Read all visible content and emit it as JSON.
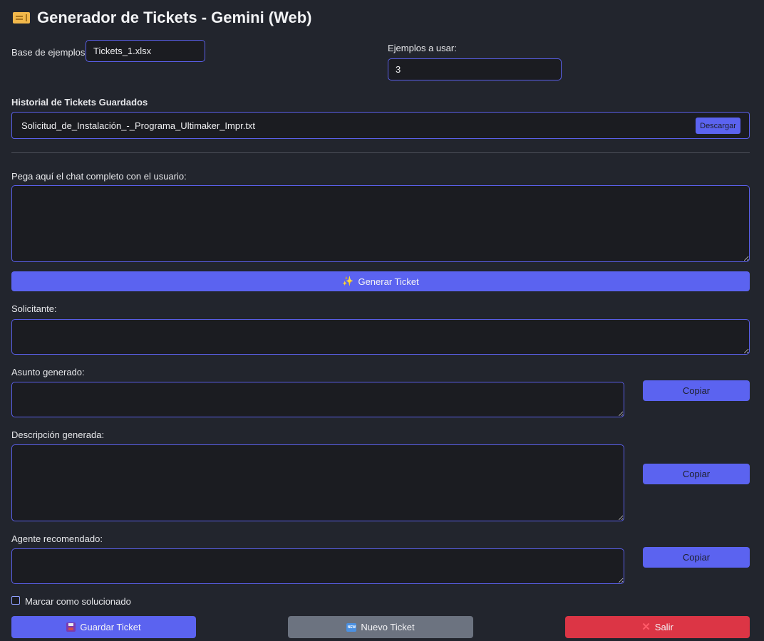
{
  "app": {
    "title": "Generador de Tickets - Gemini (Web)",
    "title_icon": "ticket-icon"
  },
  "config": {
    "base_label": "Base de ejemplos:",
    "base_value": "Tickets_1.xlsx",
    "examples_label": "Ejemplos a usar:",
    "examples_value": "3"
  },
  "history": {
    "heading": "Historial de Tickets Guardados",
    "file": "Solicitud_de_Instalación_-_Programa_Ultimaker_Impr.txt",
    "download_label": "Descargar"
  },
  "chat": {
    "label": "Pega aquí el chat completo con el usuario:",
    "value": ""
  },
  "generate": {
    "icon": "sparkles-icon",
    "label": "Generar Ticket"
  },
  "fields": {
    "requester_label": "Solicitante:",
    "requester_value": "",
    "subject_label": "Asunto generado:",
    "subject_value": "",
    "description_label": "Descripción generada:",
    "description_value": "",
    "agent_label": "Agente recomendado:",
    "agent_value": "",
    "copy_label": "Copiar"
  },
  "solved": {
    "label": "Marcar como solucionado",
    "checked": false
  },
  "actions": {
    "save_label": "Guardar Ticket",
    "save_icon": "floppy-disk-icon",
    "new_label": "Nuevo Ticket",
    "new_icon": "new-badge-icon",
    "new_icon_text": "NEW",
    "exit_label": "Salir",
    "exit_icon": "cross-mark-icon"
  },
  "colors": {
    "background": "#22252d",
    "field_background": "#1b1c21",
    "accent": "#5b63f0",
    "secondary": "#6c7380",
    "danger": "#dc3545"
  }
}
